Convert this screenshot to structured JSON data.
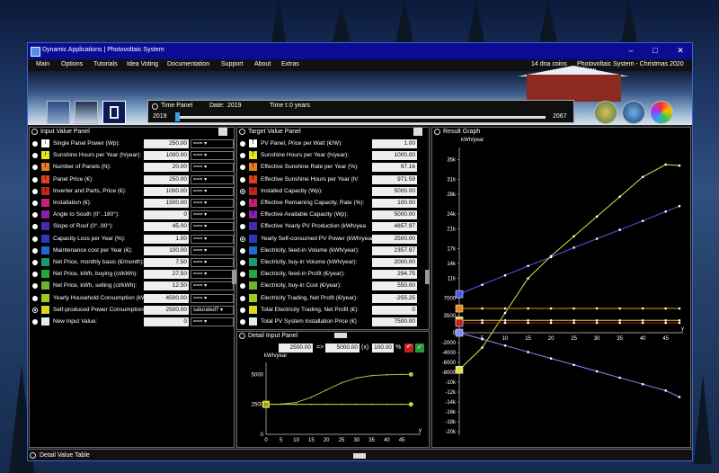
{
  "window": {
    "title": "Dynamic Applications | Photovoltaic System"
  },
  "menu": {
    "items": [
      "Main",
      "Options",
      "Tutorials",
      "Idea Voting",
      "Documentation",
      "Support",
      "About",
      "Extras"
    ],
    "coins": "14 dna coins",
    "edition": "Photovoltaic System - Christmas 2020 Edition"
  },
  "time_panel": {
    "label": "Time Panel",
    "date_label": "Date:",
    "date_value": "2019",
    "time_label": "Time t:",
    "time_value": "0 years",
    "start_year": "2019",
    "end_year": "2067",
    "slider_fraction": 0
  },
  "input_panel": {
    "title": "Input Value Panel",
    "rows": [
      {
        "icon": "i",
        "color": "#ffffff",
        "label": "Single Panel Power (Wp):",
        "value": "250.00",
        "dd": "===",
        "radio": false
      },
      {
        "icon": "I",
        "color": "#e8e31e",
        "label": "Sunshine Hours per Year (h/year):",
        "value": "1000.00",
        "dd": "===",
        "radio": false
      },
      {
        "icon": "I",
        "color": "#e87a1c",
        "label": "Number of Panels (N):",
        "value": "20.00",
        "dd": "===",
        "radio": false
      },
      {
        "icon": "I",
        "color": "#d8441a",
        "label": "Panel Price (€):",
        "value": "250.00",
        "dd": "===",
        "radio": false
      },
      {
        "icon": "I",
        "color": "#c32222",
        "label": "Inverter and Parts, Price (€):",
        "value": "1000.00",
        "dd": "===",
        "radio": false
      },
      {
        "icon": "",
        "color": "#c02078",
        "label": "Installation (€):",
        "value": "1500.00",
        "dd": "===",
        "radio": false
      },
      {
        "icon": "",
        "color": "#8a1fa8",
        "label": "Angle to South (0°..180°):",
        "value": "0",
        "dd": "===",
        "radio": false
      },
      {
        "icon": "",
        "color": "#4b26b0",
        "label": "Slope of Roof (0°..90°):",
        "value": "45.00",
        "dd": "===",
        "radio": false
      },
      {
        "icon": "",
        "color": "#2b3aba",
        "label": "Capacity Loss per Year (%):",
        "value": "1.00",
        "dd": "===",
        "radio": false
      },
      {
        "icon": "",
        "color": "#1d6ad2",
        "label": "Maintenance cost per Year (€):",
        "value": "100.00",
        "dd": "===",
        "radio": false
      },
      {
        "icon": "",
        "color": "#1a9a6c",
        "label": "Net Price, monthly basic (€/month):",
        "value": "7.50",
        "dd": "===",
        "radio": false
      },
      {
        "icon": "",
        "color": "#23a83a",
        "label": "Net Price, kWh, buying (ct/kWh):",
        "value": "27.50",
        "dd": "===",
        "radio": false
      },
      {
        "icon": "",
        "color": "#68b82a",
        "label": "Net Price, kWh, selling (ct/kWh):",
        "value": "12.50",
        "dd": "===",
        "radio": false
      },
      {
        "icon": "",
        "color": "#a7c824",
        "label": "Yearly Household Consumption (kW",
        "value": "4500.00",
        "dd": "===",
        "radio": false
      },
      {
        "icon": "",
        "color": "#d9d522",
        "label": "Self-produced Power Consumption",
        "value": "2500.00",
        "dd": "saturated?",
        "radio": true
      },
      {
        "icon": "",
        "color": "#eaeaea",
        "label": "New Input Value:",
        "value": "0",
        "dd": "===",
        "radio": false
      }
    ]
  },
  "target_panel": {
    "title": "Target Value Panel",
    "rows": [
      {
        "icon": "T",
        "color": "#ffffff",
        "label": "PV Panel, Price per Watt (€/W):",
        "value": "1.00",
        "radio": false
      },
      {
        "icon": "T",
        "color": "#e8e31e",
        "label": "Sunshine Hours per Year (h/year):",
        "value": "1000.00",
        "radio": false
      },
      {
        "icon": "T",
        "color": "#e87a1c",
        "label": "Effective Sunshine Rate per Year (%):",
        "value": "97.16",
        "radio": false
      },
      {
        "icon": "T",
        "color": "#d8441a",
        "label": "Effective Sunshine Hours per Year (h/",
        "value": "971.59",
        "radio": false
      },
      {
        "icon": "T",
        "color": "#c32222",
        "label": "Installed Capacity (Wp):",
        "value": "5000.00",
        "radio": true
      },
      {
        "icon": "T",
        "color": "#c02078",
        "label": "Effective Remaining Capacity, Rate (%):",
        "value": "100.00",
        "radio": false
      },
      {
        "icon": "T",
        "color": "#8a1fa8",
        "label": "Effective Available Capacity (Wp):",
        "value": "5000.00",
        "radio": false
      },
      {
        "icon": "",
        "color": "#4b26b0",
        "label": "Effective Yearly PV Production (kWh/yea",
        "value": "4857.97",
        "radio": false
      },
      {
        "icon": "",
        "color": "#2b3aba",
        "label": "Yearly Self-consumed PV Power (kWh/year",
        "value": "2500.00",
        "radio": true
      },
      {
        "icon": "",
        "color": "#1d6ad2",
        "label": "Electricity, feed-in Volume (kWh/year):",
        "value": "2357.97",
        "radio": false
      },
      {
        "icon": "",
        "color": "#1a9a6c",
        "label": "Electricity, buy-in Volume (kWh/year):",
        "value": "2000.00",
        "radio": false
      },
      {
        "icon": "",
        "color": "#23a83a",
        "label": "Electricity, feed-in Profit (€/year):",
        "value": "294.75",
        "radio": false
      },
      {
        "icon": "",
        "color": "#68b82a",
        "label": "Electricity, buy-in Cost (€/year):",
        "value": "550.00",
        "radio": false
      },
      {
        "icon": "",
        "color": "#a7c824",
        "label": "Electricity Trading, Net Profit (€/year):",
        "value": "-255.25",
        "radio": false
      },
      {
        "icon": "",
        "color": "#d9d522",
        "label": "Total Electricity Trading, Net Profit (€):",
        "value": "0",
        "radio": false
      },
      {
        "icon": "",
        "color": "#eaeaea",
        "label": "Total PV System Installation Price (€)",
        "value": "7500.00",
        "radio": false
      }
    ]
  },
  "detail_input_panel": {
    "title": "Detail Input Panel",
    "from": "2500.00",
    "arrow": "=>",
    "to": "5000.00",
    "mult": "(x)",
    "percent": "100.00",
    "percent_unit": "%",
    "ylabel": "kWh/year",
    "xlabel": "y",
    "chart_data": {
      "type": "line",
      "x": [
        0,
        5,
        10,
        15,
        20,
        25,
        30,
        35,
        40,
        45,
        48
      ],
      "ylim": [
        0,
        6000
      ],
      "yticks": [
        0,
        2500,
        5000
      ],
      "xticks": [
        0,
        5,
        10,
        15,
        20,
        25,
        30,
        35,
        40,
        45
      ],
      "series": [
        {
          "values": [
            2500,
            2520,
            2650,
            3100,
            3700,
            4300,
            4700,
            4900,
            4970,
            4995,
            5000
          ],
          "color": "#b8c23a"
        },
        {
          "values": [
            2500,
            2500,
            2500,
            2500,
            2500,
            2500,
            2500,
            2500,
            2500,
            2500,
            2500
          ],
          "color": "#d6d837"
        }
      ],
      "marker_label": "Ia"
    }
  },
  "result_graph": {
    "title": "Result Graph",
    "ylabel": "kWh/year",
    "xlabel": "y",
    "chart_data": {
      "type": "line",
      "x": [
        0,
        5,
        10,
        15,
        20,
        25,
        30,
        35,
        40,
        45,
        48
      ],
      "ylim": [
        -20000,
        36000
      ],
      "xlim": [
        0,
        48
      ],
      "yticks": [
        -20000,
        -18000,
        -16000,
        -14000,
        -12000,
        -10000,
        -8000,
        -6000,
        -4000,
        -2000,
        0,
        3500,
        7000,
        11000,
        14000,
        17000,
        21000,
        24000,
        28000,
        31000,
        35000
      ],
      "ytick_labels": [
        "-20k",
        "-18k",
        "-16k",
        "-14k",
        "-12k",
        "-10k",
        "-8000",
        "-6000",
        "-4000",
        "-2000",
        "0",
        "3500",
        "7000",
        "11k",
        "14k",
        "17k",
        "21k",
        "24k",
        "28k",
        "31k",
        "35k"
      ],
      "xticks": [
        5,
        10,
        15,
        20,
        25,
        30,
        35,
        40,
        45
      ],
      "series": [
        {
          "values": [
            7800,
            9700,
            11600,
            13500,
            15300,
            17200,
            19000,
            20800,
            22600,
            24500,
            25600
          ],
          "color": "#4a5ae8"
        },
        {
          "values": [
            -7500,
            -3000,
            4000,
            11000,
            15500,
            19500,
            23500,
            27500,
            31500,
            34000,
            33800
          ],
          "color": "#e2e248"
        },
        {
          "values": [
            4900,
            4900,
            4900,
            4900,
            4900,
            4900,
            4900,
            4900,
            4900,
            4900,
            4900
          ],
          "color": "#e8891e"
        },
        {
          "values": [
            2500,
            2500,
            2500,
            2500,
            2500,
            2500,
            2500,
            2500,
            2500,
            2500,
            2500
          ],
          "color": "#d6d837"
        },
        {
          "values": [
            2000,
            2000,
            2000,
            2000,
            2000,
            2000,
            2000,
            2000,
            2000,
            2000,
            2000
          ],
          "color": "#c32222"
        },
        {
          "values": [
            0,
            -1300,
            -2600,
            -3900,
            -5200,
            -6500,
            -7800,
            -9100,
            -10400,
            -11700,
            -13000
          ],
          "color": "#8a8aff"
        }
      ]
    }
  },
  "detail_table": {
    "title": "Detail Value Table"
  }
}
